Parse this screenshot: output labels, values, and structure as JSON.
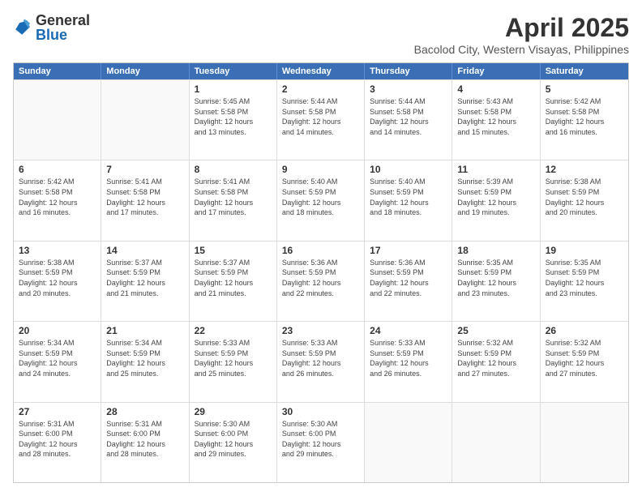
{
  "logo": {
    "general": "General",
    "blue": "Blue"
  },
  "header": {
    "title": "April 2025",
    "subtitle": "Bacolod City, Western Visayas, Philippines"
  },
  "weekdays": [
    "Sunday",
    "Monday",
    "Tuesday",
    "Wednesday",
    "Thursday",
    "Friday",
    "Saturday"
  ],
  "weeks": [
    [
      {
        "day": "",
        "info": ""
      },
      {
        "day": "",
        "info": ""
      },
      {
        "day": "1",
        "info": "Sunrise: 5:45 AM\nSunset: 5:58 PM\nDaylight: 12 hours\nand 13 minutes."
      },
      {
        "day": "2",
        "info": "Sunrise: 5:44 AM\nSunset: 5:58 PM\nDaylight: 12 hours\nand 14 minutes."
      },
      {
        "day": "3",
        "info": "Sunrise: 5:44 AM\nSunset: 5:58 PM\nDaylight: 12 hours\nand 14 minutes."
      },
      {
        "day": "4",
        "info": "Sunrise: 5:43 AM\nSunset: 5:58 PM\nDaylight: 12 hours\nand 15 minutes."
      },
      {
        "day": "5",
        "info": "Sunrise: 5:42 AM\nSunset: 5:58 PM\nDaylight: 12 hours\nand 16 minutes."
      }
    ],
    [
      {
        "day": "6",
        "info": "Sunrise: 5:42 AM\nSunset: 5:58 PM\nDaylight: 12 hours\nand 16 minutes."
      },
      {
        "day": "7",
        "info": "Sunrise: 5:41 AM\nSunset: 5:58 PM\nDaylight: 12 hours\nand 17 minutes."
      },
      {
        "day": "8",
        "info": "Sunrise: 5:41 AM\nSunset: 5:58 PM\nDaylight: 12 hours\nand 17 minutes."
      },
      {
        "day": "9",
        "info": "Sunrise: 5:40 AM\nSunset: 5:59 PM\nDaylight: 12 hours\nand 18 minutes."
      },
      {
        "day": "10",
        "info": "Sunrise: 5:40 AM\nSunset: 5:59 PM\nDaylight: 12 hours\nand 18 minutes."
      },
      {
        "day": "11",
        "info": "Sunrise: 5:39 AM\nSunset: 5:59 PM\nDaylight: 12 hours\nand 19 minutes."
      },
      {
        "day": "12",
        "info": "Sunrise: 5:38 AM\nSunset: 5:59 PM\nDaylight: 12 hours\nand 20 minutes."
      }
    ],
    [
      {
        "day": "13",
        "info": "Sunrise: 5:38 AM\nSunset: 5:59 PM\nDaylight: 12 hours\nand 20 minutes."
      },
      {
        "day": "14",
        "info": "Sunrise: 5:37 AM\nSunset: 5:59 PM\nDaylight: 12 hours\nand 21 minutes."
      },
      {
        "day": "15",
        "info": "Sunrise: 5:37 AM\nSunset: 5:59 PM\nDaylight: 12 hours\nand 21 minutes."
      },
      {
        "day": "16",
        "info": "Sunrise: 5:36 AM\nSunset: 5:59 PM\nDaylight: 12 hours\nand 22 minutes."
      },
      {
        "day": "17",
        "info": "Sunrise: 5:36 AM\nSunset: 5:59 PM\nDaylight: 12 hours\nand 22 minutes."
      },
      {
        "day": "18",
        "info": "Sunrise: 5:35 AM\nSunset: 5:59 PM\nDaylight: 12 hours\nand 23 minutes."
      },
      {
        "day": "19",
        "info": "Sunrise: 5:35 AM\nSunset: 5:59 PM\nDaylight: 12 hours\nand 23 minutes."
      }
    ],
    [
      {
        "day": "20",
        "info": "Sunrise: 5:34 AM\nSunset: 5:59 PM\nDaylight: 12 hours\nand 24 minutes."
      },
      {
        "day": "21",
        "info": "Sunrise: 5:34 AM\nSunset: 5:59 PM\nDaylight: 12 hours\nand 25 minutes."
      },
      {
        "day": "22",
        "info": "Sunrise: 5:33 AM\nSunset: 5:59 PM\nDaylight: 12 hours\nand 25 minutes."
      },
      {
        "day": "23",
        "info": "Sunrise: 5:33 AM\nSunset: 5:59 PM\nDaylight: 12 hours\nand 26 minutes."
      },
      {
        "day": "24",
        "info": "Sunrise: 5:33 AM\nSunset: 5:59 PM\nDaylight: 12 hours\nand 26 minutes."
      },
      {
        "day": "25",
        "info": "Sunrise: 5:32 AM\nSunset: 5:59 PM\nDaylight: 12 hours\nand 27 minutes."
      },
      {
        "day": "26",
        "info": "Sunrise: 5:32 AM\nSunset: 5:59 PM\nDaylight: 12 hours\nand 27 minutes."
      }
    ],
    [
      {
        "day": "27",
        "info": "Sunrise: 5:31 AM\nSunset: 6:00 PM\nDaylight: 12 hours\nand 28 minutes."
      },
      {
        "day": "28",
        "info": "Sunrise: 5:31 AM\nSunset: 6:00 PM\nDaylight: 12 hours\nand 28 minutes."
      },
      {
        "day": "29",
        "info": "Sunrise: 5:30 AM\nSunset: 6:00 PM\nDaylight: 12 hours\nand 29 minutes."
      },
      {
        "day": "30",
        "info": "Sunrise: 5:30 AM\nSunset: 6:00 PM\nDaylight: 12 hours\nand 29 minutes."
      },
      {
        "day": "",
        "info": ""
      },
      {
        "day": "",
        "info": ""
      },
      {
        "day": "",
        "info": ""
      }
    ]
  ]
}
